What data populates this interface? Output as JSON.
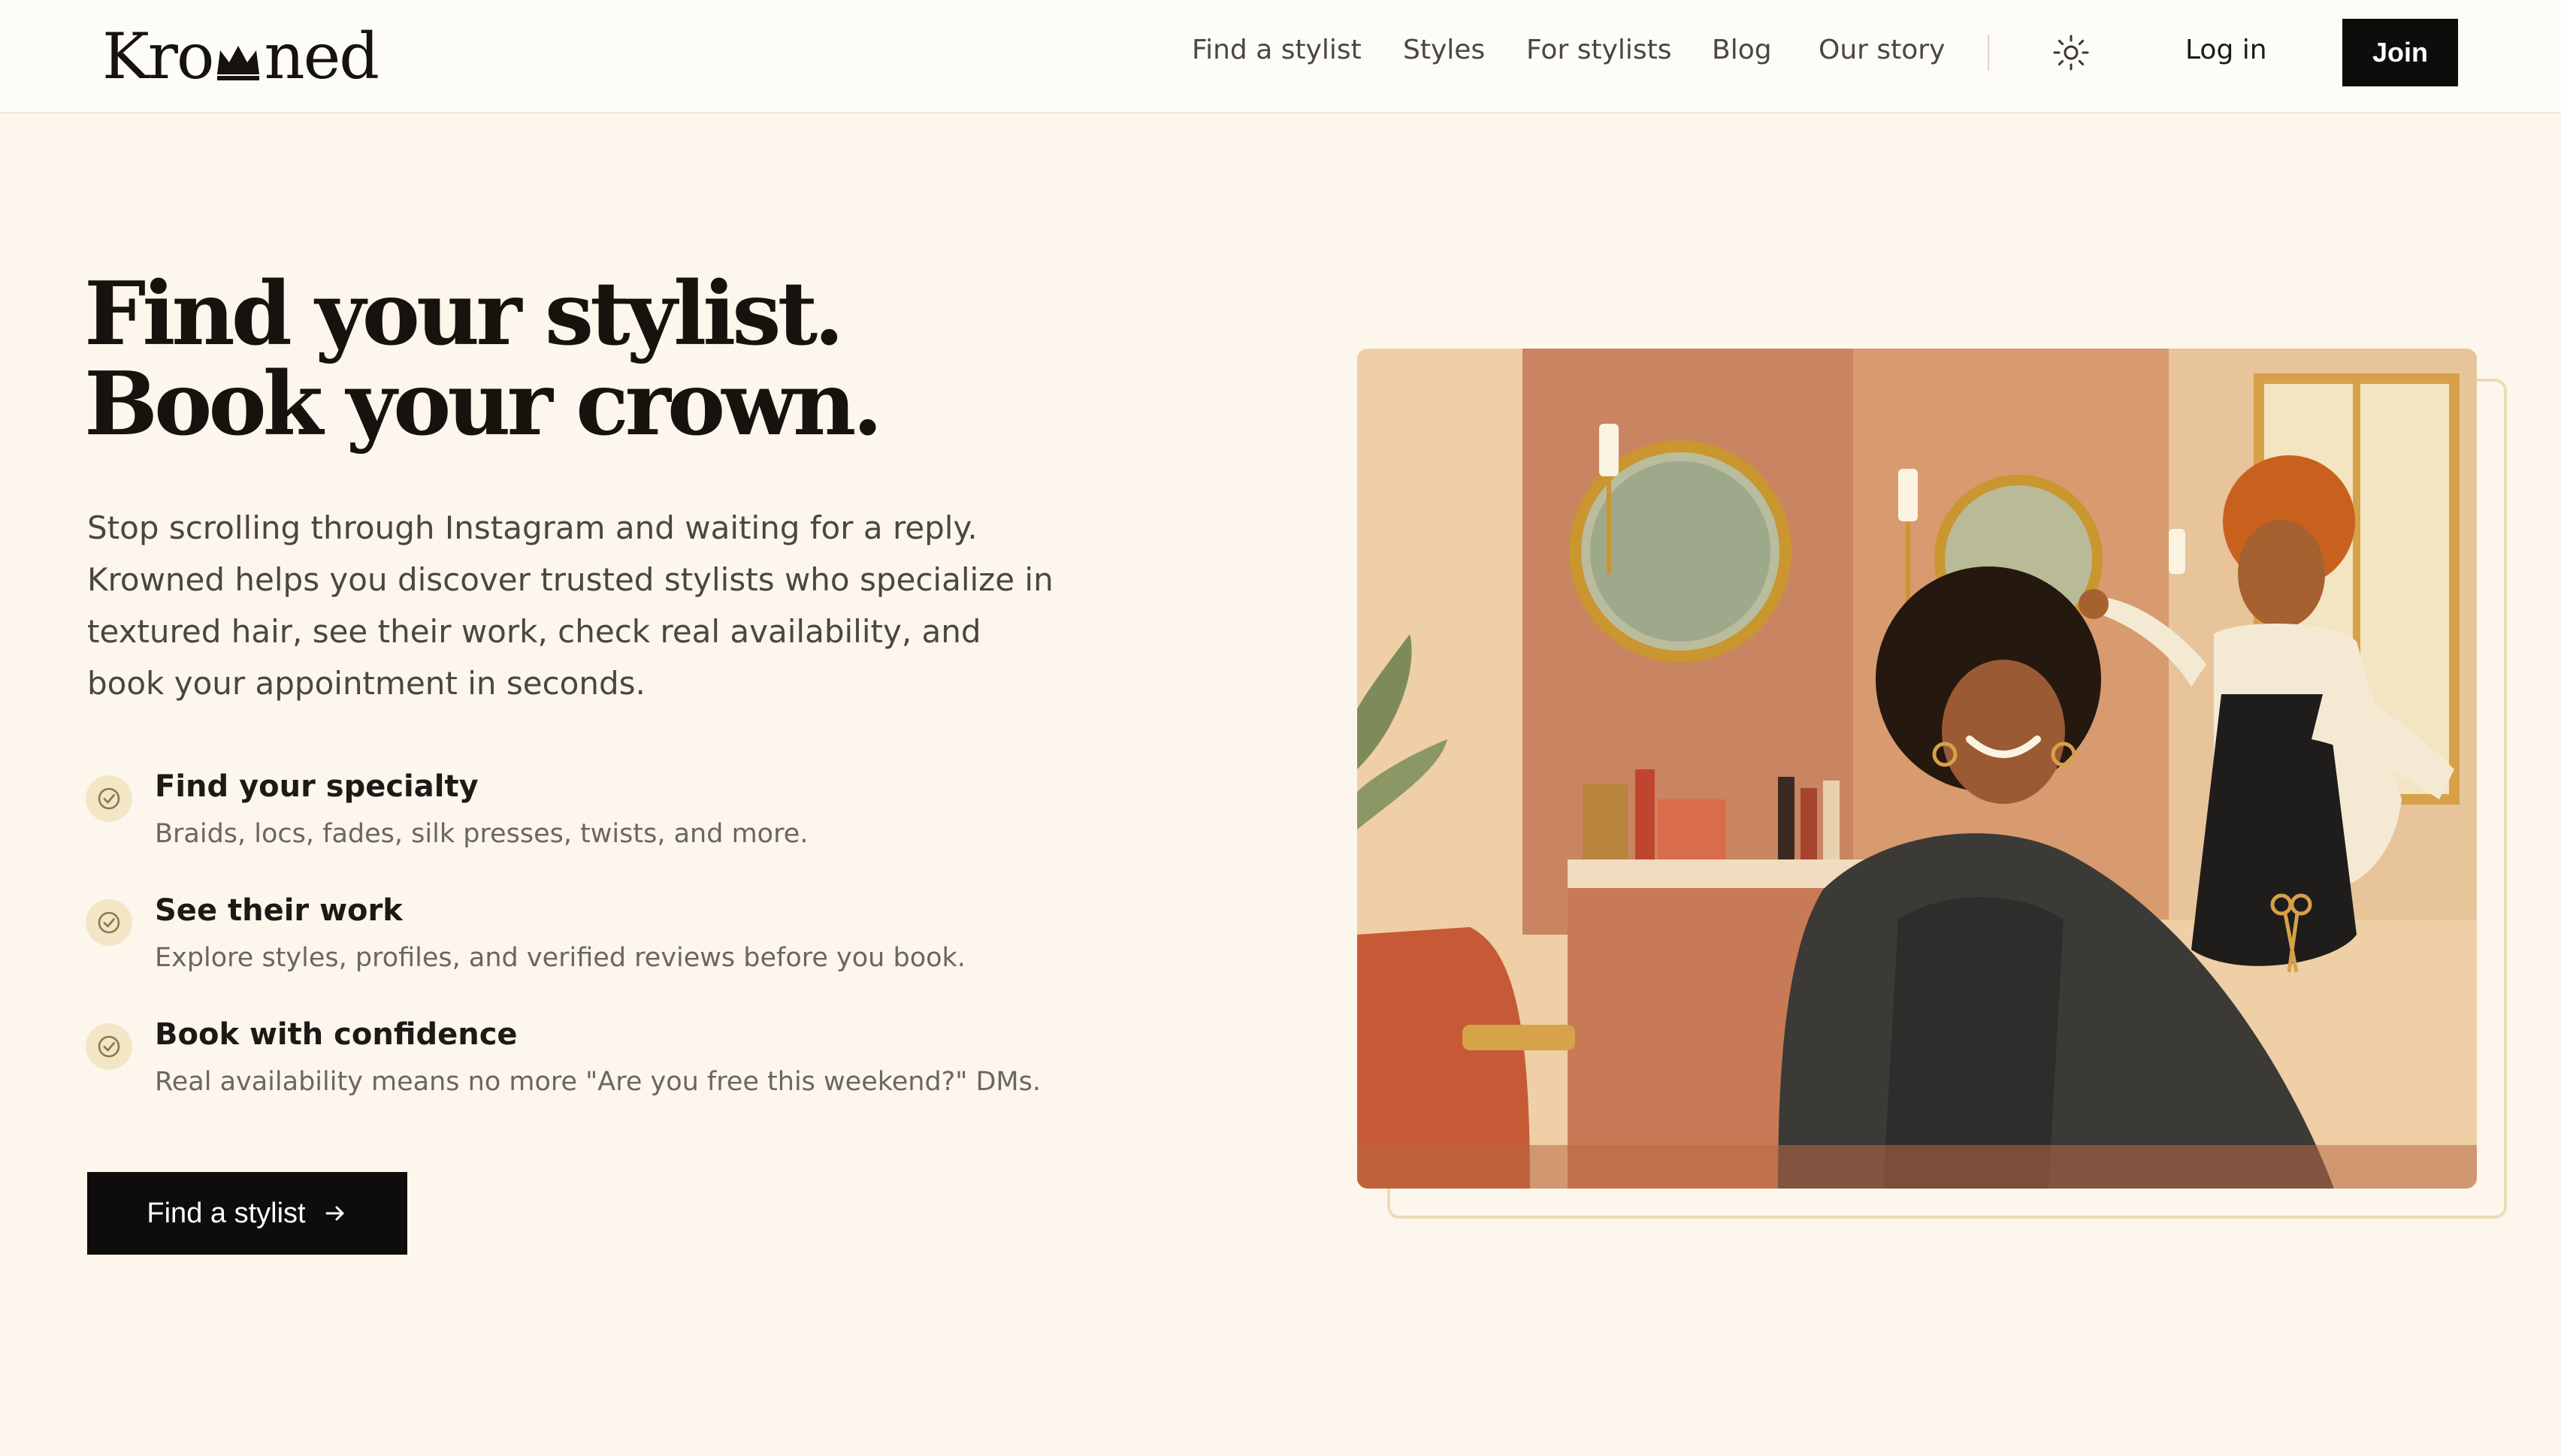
{
  "header": {
    "logo": "Krowned",
    "nav": [
      {
        "label": "Find a stylist"
      },
      {
        "label": "Styles"
      },
      {
        "label": "For stylists"
      },
      {
        "label": "Blog"
      },
      {
        "label": "Our story"
      }
    ],
    "theme_toggle_icon": "sun-icon",
    "login_label": "Log in",
    "join_label": "Join"
  },
  "hero": {
    "title_line1": "Find your stylist.",
    "title_line2": "Book your crown.",
    "description": "Stop scrolling through Instagram and waiting for a reply. Krowned helps you discover trusted stylists who specialize in textured hair, see their work, check real availability, and book your appointment in seconds.",
    "features": [
      {
        "title": "Find your specialty",
        "description": "Braids, locs, fades, silk presses, twists, and more.",
        "icon": "check-circle-icon"
      },
      {
        "title": "See their work",
        "description": "Explore styles, profiles, and verified reviews before you book.",
        "icon": "check-circle-icon"
      },
      {
        "title": "Book with confidence",
        "description": "Real availability means no more \"Are you free this weekend?\" DMs.",
        "icon": "check-circle-icon"
      }
    ],
    "cta_label": "Find a stylist",
    "cta_icon": "arrow-right-icon"
  },
  "colors": {
    "background": "#fdf6ec",
    "header_background": "#fefcf8",
    "primary_button": "#0f0d0b",
    "check_badge": "#f3e6c6",
    "frame_accent": "#ecdcb7"
  }
}
